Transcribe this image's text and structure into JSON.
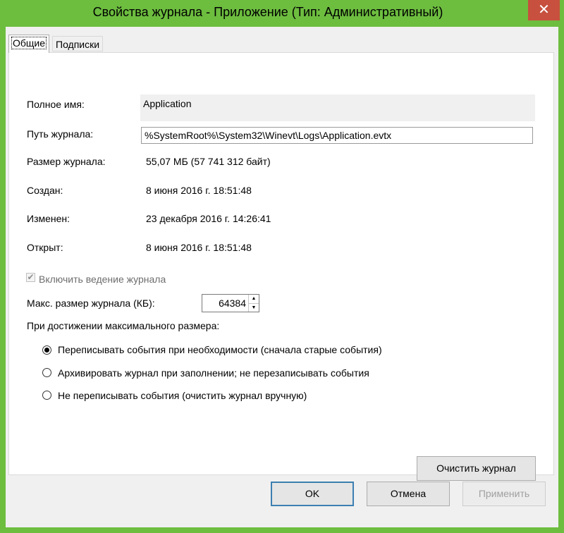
{
  "window": {
    "title": "Свойства журнала - Приложение (Тип: Административный)",
    "close_glyph": "✕"
  },
  "tabs": [
    {
      "label": "Общие",
      "active": true
    },
    {
      "label": "Подписки",
      "active": false
    }
  ],
  "general": {
    "full_name_label": "Полное имя:",
    "full_name_value": "Application",
    "log_path_label": "Путь журнала:",
    "log_path_value": "%SystemRoot%\\System32\\Winevt\\Logs\\Application.evtx",
    "log_size_label": "Размер журнала:",
    "log_size_value": "55,07 МБ (57 741 312 байт)",
    "created_label": "Создан:",
    "created_value": "8 июня 2016 г. 18:51:48",
    "modified_label": "Изменен:",
    "modified_value": "23 декабря 2016 г. 14:26:41",
    "opened_label": "Открыт:",
    "opened_value": "8 июня 2016 г. 18:51:48",
    "enable_logging_label": "Включить ведение журнала",
    "enable_logging_checked": true,
    "max_size_label": "Макс. размер журнала (КБ):",
    "max_size_value": "64384",
    "on_max_label": "При достижении максимального размера:",
    "options": [
      {
        "label": "Переписывать события при необходимости (сначала старые события)",
        "selected": true
      },
      {
        "label": "Архивировать журнал при заполнении; не перезаписывать события",
        "selected": false
      },
      {
        "label": "Не переписывать события (очистить журнал вручную)",
        "selected": false
      }
    ],
    "clear_log_label": "Очистить журнал"
  },
  "footer": {
    "ok_label": "OK",
    "cancel_label": "Отмена",
    "apply_label": "Применить"
  },
  "colors": {
    "frame": "#6dbd3f",
    "close_button": "#c7503e"
  }
}
